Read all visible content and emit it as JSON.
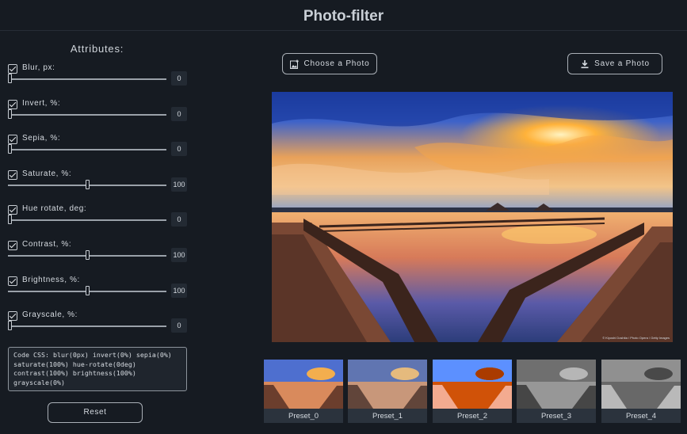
{
  "app": {
    "title": "Photo-filter"
  },
  "sidebar": {
    "title": "Attributes:",
    "attributes": [
      {
        "label": "Blur, px:",
        "value": "0",
        "fraction": 0
      },
      {
        "label": "Invert, %:",
        "value": "0",
        "fraction": 0
      },
      {
        "label": "Sepia, %:",
        "value": "0",
        "fraction": 0
      },
      {
        "label": "Saturate, %:",
        "value": "100",
        "fraction": 0.5
      },
      {
        "label": "Hue rotate, deg:",
        "value": "0",
        "fraction": 0
      },
      {
        "label": "Contrast, %:",
        "value": "100",
        "fraction": 0.5
      },
      {
        "label": "Brightness, %:",
        "value": "100",
        "fraction": 0.5
      },
      {
        "label": "Grayscale, %:",
        "value": "0",
        "fraction": 0
      }
    ],
    "code_css": "Code CSS: blur(0px) invert(0%) sepia(0%) saturate(100%) hue-rotate(0deg) contrast(100%) brightness(100%) grayscale(0%)",
    "reset_label": "Reset"
  },
  "toolbar": {
    "choose_label": "Choose a Photo",
    "choose_icon": "image-add-icon",
    "save_label": "Save a Photo",
    "save_icon": "download-icon"
  },
  "photo": {
    "credit": "© Kiyoshi Doshita / Photo Opera / Getty Images"
  },
  "presets": [
    {
      "label": "Preset_0"
    },
    {
      "label": "Preset_1"
    },
    {
      "label": "Preset_2"
    },
    {
      "label": "Preset_3"
    },
    {
      "label": "Preset_4"
    }
  ],
  "colors": {
    "background": "#161b22",
    "control_bg": "#232a33",
    "border": "#aab0b7",
    "text": "#d6dbe1"
  }
}
